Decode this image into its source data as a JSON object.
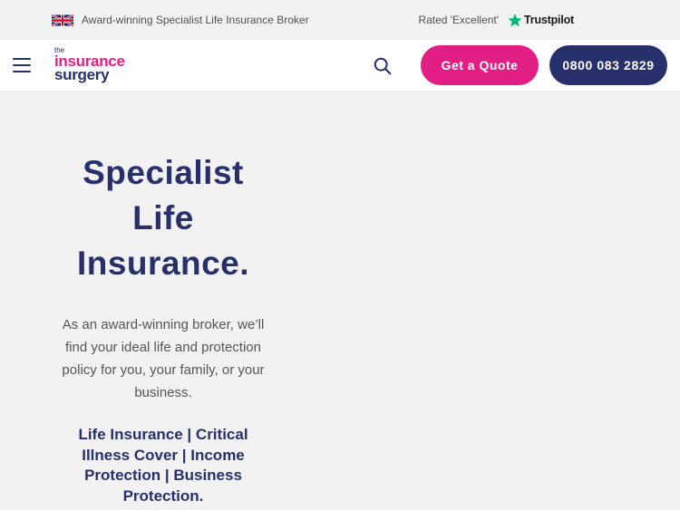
{
  "topbar": {
    "flag_icon": "uk-flag-icon",
    "tagline": "Award-winning Specialist Life Insurance Broker",
    "rated": "Rated 'Excellent'",
    "trustpilot_icon": "trustpilot-star-icon",
    "trustpilot": "Trustpilot"
  },
  "header": {
    "menu_icon": "hamburger-menu-icon",
    "logo": {
      "the": "the",
      "line1": "insurance",
      "line2": "surgery"
    },
    "search_icon": "search-icon",
    "quote_label": "Get a Quote",
    "phone_label": "0800 083 2829",
    "colors": {
      "pink": "#e21d84",
      "navy": "#27306b"
    }
  },
  "hero": {
    "title_line1": "Specialist",
    "title_line2": "Life",
    "title_line3": "Insurance.",
    "lead": "As an award-winning broker, we’ll find your ideal life and protection policy for you, your family, or your business.",
    "products": "Life Insurance | Critical Illness Cover | Income Protection | Business Protection."
  }
}
